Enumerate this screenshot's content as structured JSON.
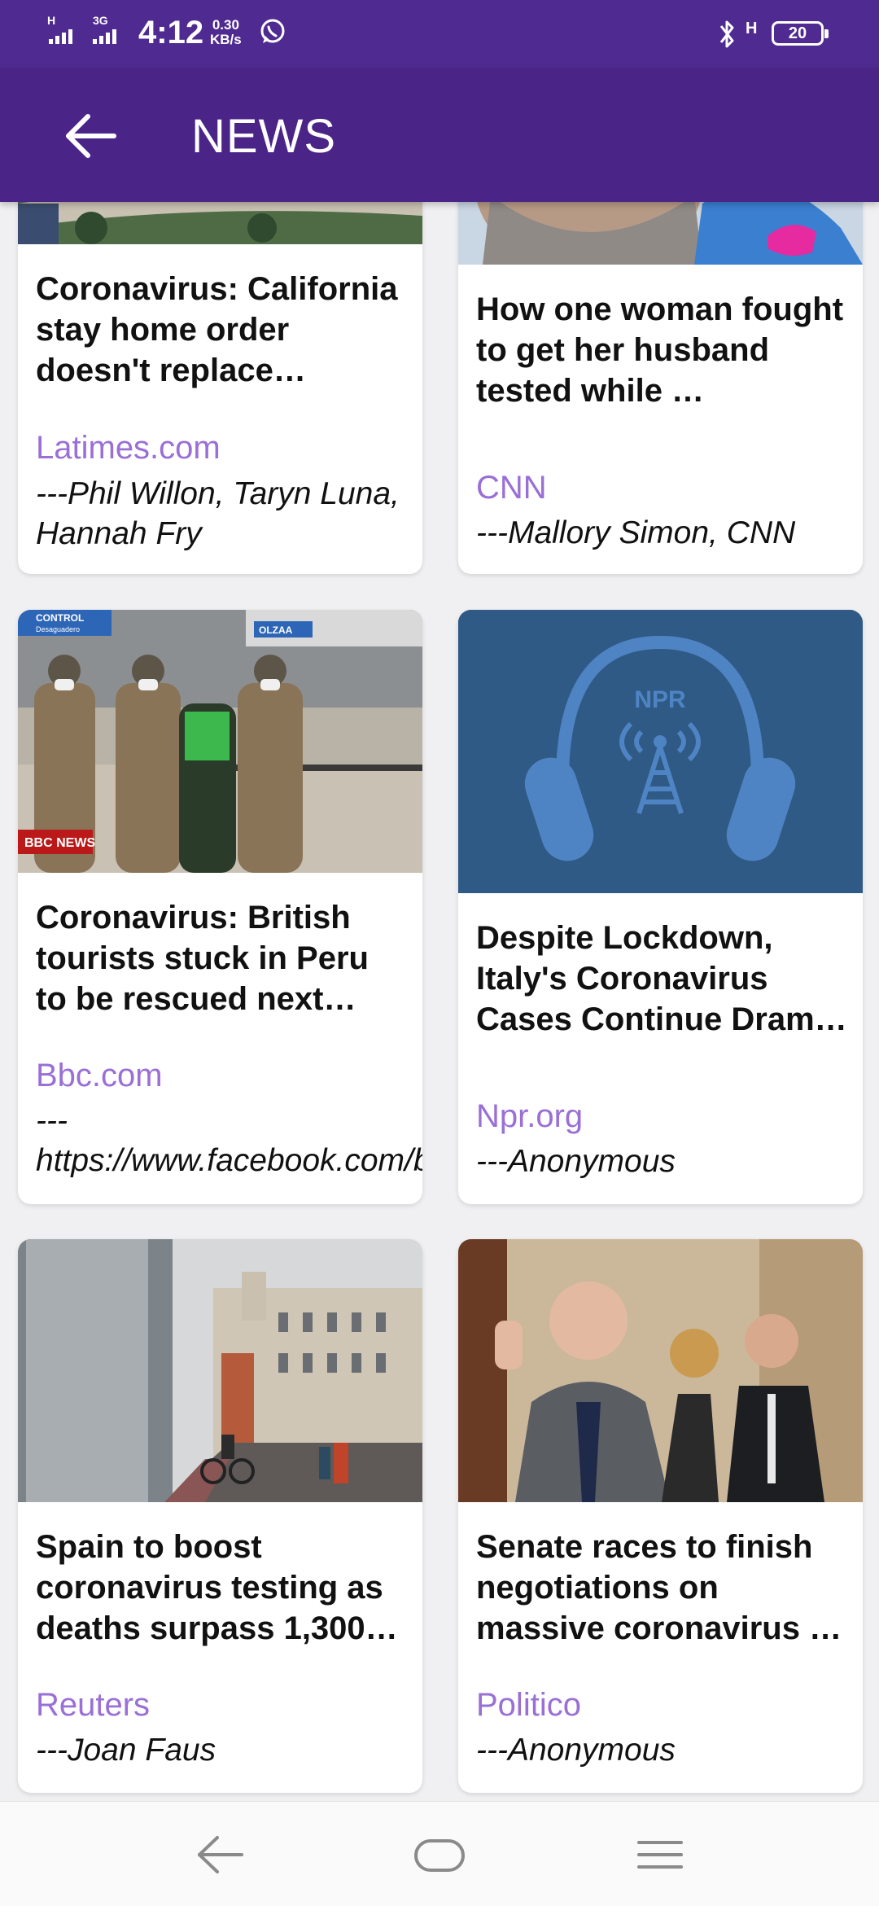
{
  "status_bar": {
    "network": "H 3G",
    "time": "4:12",
    "speed_value": "0.30",
    "speed_unit": "KB/s",
    "network_type": "H",
    "battery": "20"
  },
  "app_bar": {
    "title": "NEWS"
  },
  "articles": [
    {
      "title": "Coronavirus: California stay home order doesn't replace stricte…",
      "source": "Latimes.com",
      "author": "---Phil Willon, Taryn Luna, Hannah Fry"
    },
    {
      "title": "How one woman fought to get her husband tested while …",
      "source": "CNN",
      "author": "---Mallory Simon, CNN"
    },
    {
      "title": "Coronavirus: British tourists stuck in Peru to be rescued next we…",
      "source": "Bbc.com",
      "author": "---https://www.facebook.com/bbcnews",
      "image_texts": [
        "CONTROL",
        "Desaguadero",
        "OLZAA",
        "BBC NEWS"
      ]
    },
    {
      "title": "Despite Lockdown, Italy's Coronavirus Cases Continue Dram…",
      "source": "Npr.org",
      "author": "---Anonymous",
      "image_logo": "NPR"
    },
    {
      "title": "Spain to boost coronavirus testing as deaths surpass 1,300…",
      "source": "Reuters",
      "author": "---Joan Faus"
    },
    {
      "title": "Senate races to finish negotiations on massive coronavirus …",
      "source": "Politico",
      "author": "---Anonymous"
    }
  ],
  "colors": {
    "status_bar": "#4f2a91",
    "app_bar": "#4b2488",
    "source_link": "#9a6fd6",
    "npr_background": "#2f5a85",
    "npr_icon": "#4f84c4"
  },
  "icons": {
    "app_bar_back": "arrow-left-icon",
    "nav_back": "nav-back-icon",
    "nav_home": "nav-home-icon",
    "nav_menu": "nav-menu-icon"
  }
}
